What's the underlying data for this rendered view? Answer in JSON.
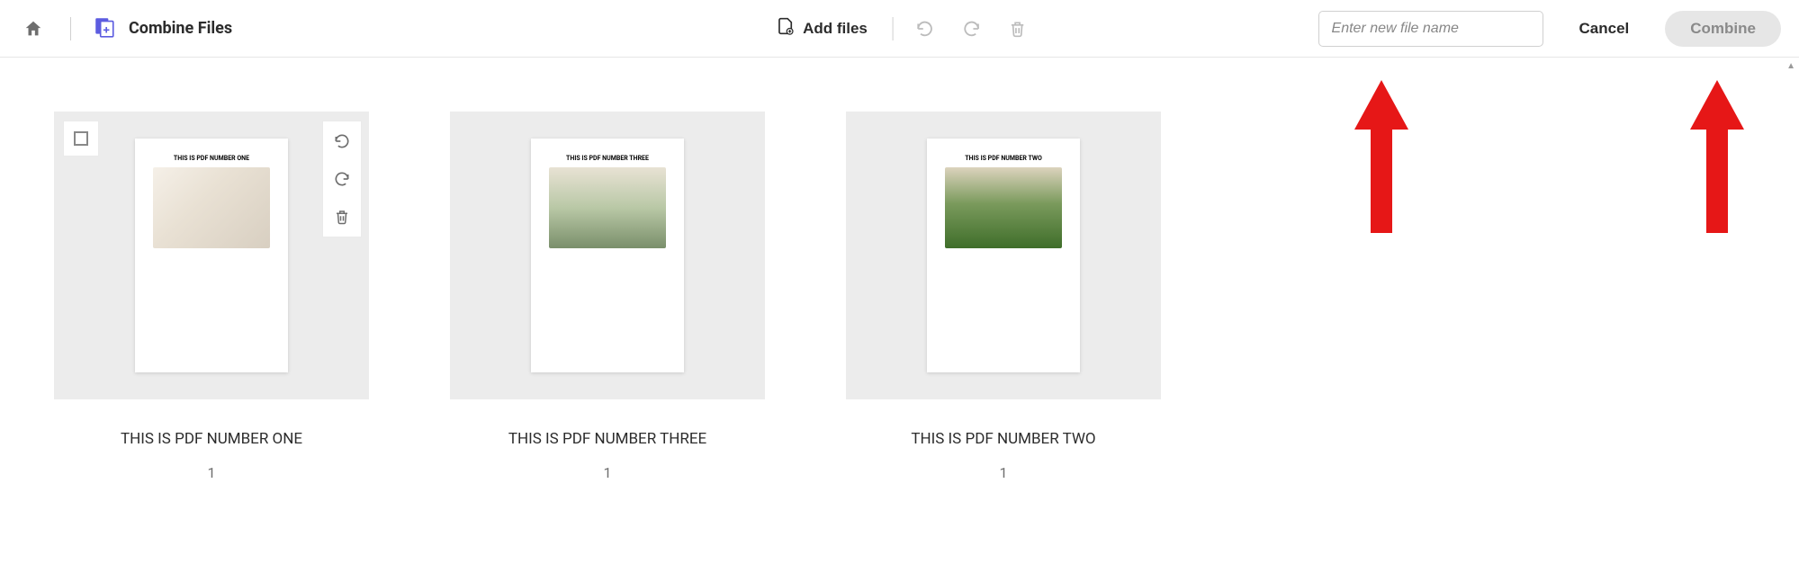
{
  "header": {
    "title": "Combine Files",
    "add_files_label": "Add files",
    "filename_placeholder": "Enter new file name",
    "cancel_label": "Cancel",
    "combine_label": "Combine"
  },
  "files": [
    {
      "filename": "THIS IS PDF NUMBER ONE",
      "preview_caption": "THIS IS PDF NUMBER ONE",
      "page_count": "1"
    },
    {
      "filename": "THIS IS PDF NUMBER THREE",
      "preview_caption": "THIS IS PDF NUMBER THREE",
      "page_count": "1"
    },
    {
      "filename": "THIS IS PDF NUMBER TWO",
      "preview_caption": "THIS IS PDF NUMBER TWO",
      "page_count": "1"
    }
  ],
  "annotations": {
    "arrow_color": "#e61717"
  }
}
